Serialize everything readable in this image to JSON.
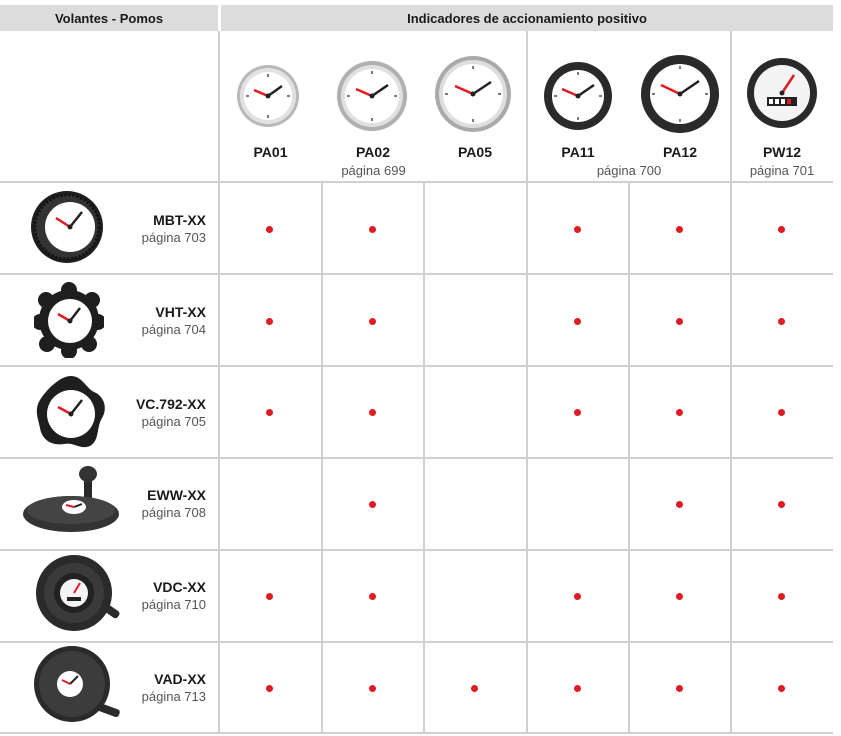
{
  "header": {
    "left": "Volantes - Pomos",
    "right": "Indicadores de accionamiento positivo"
  },
  "columns": [
    {
      "code": "PA01",
      "icon": "gauge-steel-small-icon"
    },
    {
      "code": "PA02",
      "icon": "gauge-steel-medium-icon"
    },
    {
      "code": "PA05",
      "icon": "gauge-steel-large-icon"
    },
    {
      "code": "PA11",
      "icon": "gauge-black-small-icon"
    },
    {
      "code": "PA12",
      "icon": "gauge-black-large-icon"
    },
    {
      "code": "PW12",
      "icon": "gauge-black-counter-icon"
    }
  ],
  "column_pages": {
    "pa01_pa05": "página 699",
    "pa11_pa12": "página 700",
    "pw12": "página 701"
  },
  "rows": [
    {
      "code": "MBT-XX",
      "page": "página 703",
      "icon": "handwheel-round-icon",
      "compat": [
        true,
        true,
        false,
        true,
        true,
        true
      ]
    },
    {
      "code": "VHT-XX",
      "page": "página 704",
      "icon": "handwheel-lobed-icon",
      "compat": [
        true,
        true,
        false,
        true,
        true,
        true
      ]
    },
    {
      "code": "VC.792-XX",
      "page": "página 705",
      "icon": "knob-five-lobe-icon",
      "compat": [
        true,
        true,
        false,
        true,
        true,
        true
      ]
    },
    {
      "code": "EWW-XX",
      "page": "página 708",
      "icon": "handwheel-disc-handle-icon",
      "compat": [
        false,
        true,
        false,
        false,
        true,
        true
      ]
    },
    {
      "code": "VDC-XX",
      "page": "página 710",
      "icon": "handwheel-spoked-handle-icon",
      "compat": [
        true,
        true,
        false,
        true,
        true,
        true
      ]
    },
    {
      "code": "VAD-XX",
      "page": "página 713",
      "icon": "handwheel-solid-handle-icon",
      "compat": [
        true,
        true,
        true,
        true,
        true,
        true
      ]
    }
  ],
  "colors": {
    "header_bg": "#dcdcdc",
    "grid": "#d0d0d0",
    "dot": "#e01b24"
  }
}
